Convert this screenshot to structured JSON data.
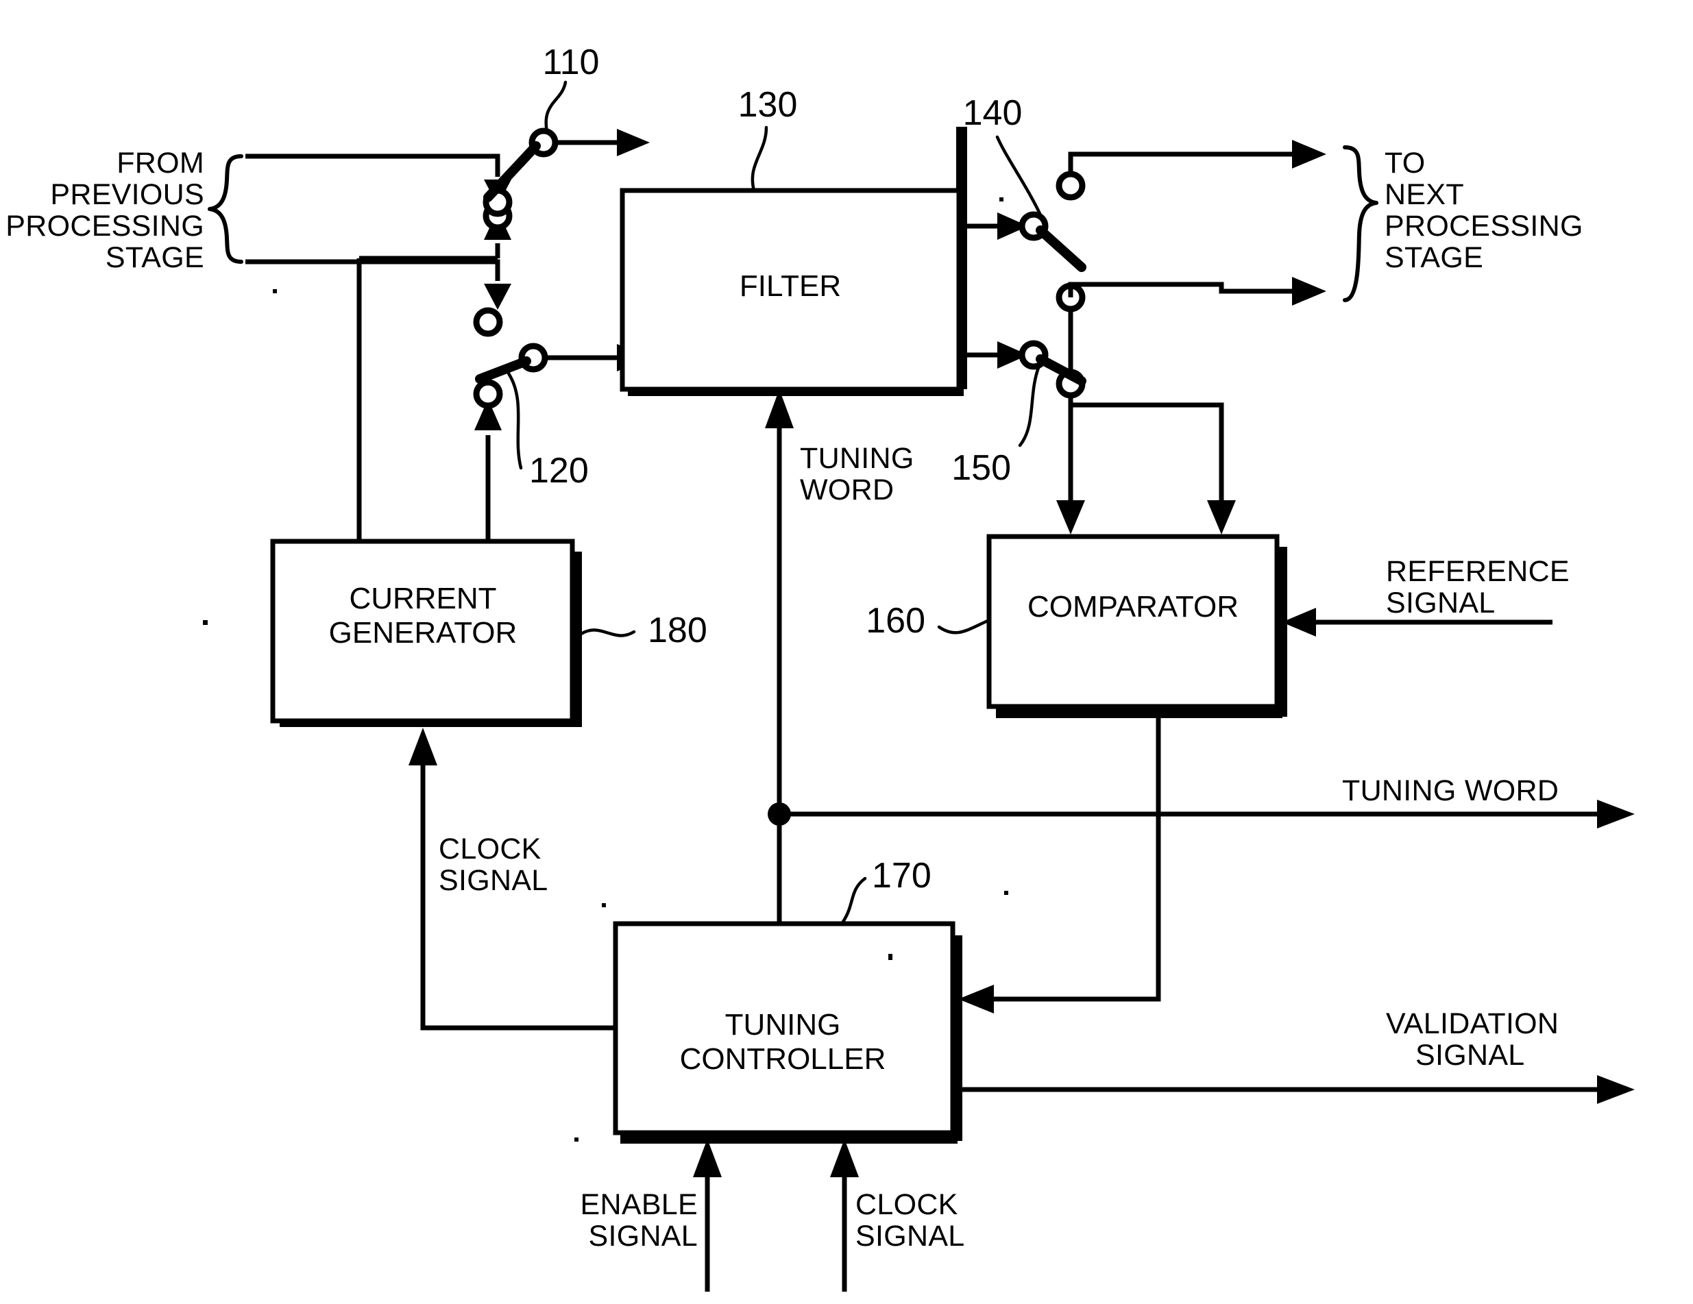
{
  "figure": {
    "type": "patent-block-diagram",
    "title": "Tunable filter calibration block diagram"
  },
  "blocks": {
    "filter": {
      "label": "FILTER",
      "ref": "130"
    },
    "current_generator": {
      "label_line1": "CURRENT",
      "label_line2": "GENERATOR",
      "ref": "180"
    },
    "comparator": {
      "label": "COMPARATOR",
      "ref": "160"
    },
    "tuning_controller": {
      "label_line1": "TUNING",
      "label_line2": "CONTROLLER",
      "ref": "170"
    }
  },
  "switches": {
    "input_upper": {
      "ref": "110"
    },
    "input_lower": {
      "ref": "120"
    },
    "output_upper": {
      "ref": "140"
    },
    "output_lower": {
      "ref": "150"
    }
  },
  "labels": {
    "from_previous_stage": {
      "line1": "FROM",
      "line2": "PREVIOUS",
      "line3": "PROCESSING",
      "line4": "STAGE"
    },
    "to_next_stage": {
      "line1": "TO",
      "line2": "NEXT",
      "line3": "PROCESSING",
      "line4": "STAGE"
    },
    "tuning_word_filter": {
      "line1": "TUNING",
      "line2": "WORD"
    },
    "clock_signal_generator": {
      "line1": "CLOCK",
      "line2": "SIGNAL"
    },
    "reference_signal": {
      "line1": "REFERENCE",
      "line2": "SIGNAL"
    },
    "tuning_word_output": {
      "line1": "TUNING WORD"
    },
    "validation_signal": {
      "line1": "VALIDATION",
      "line2": "SIGNAL"
    },
    "enable_signal": {
      "line1": "ENABLE",
      "line2": "SIGNAL"
    },
    "clock_signal_controller": {
      "line1": "CLOCK",
      "line2": "SIGNAL"
    }
  },
  "colors": {
    "ink": "#000000",
    "paper": "#ffffff"
  }
}
